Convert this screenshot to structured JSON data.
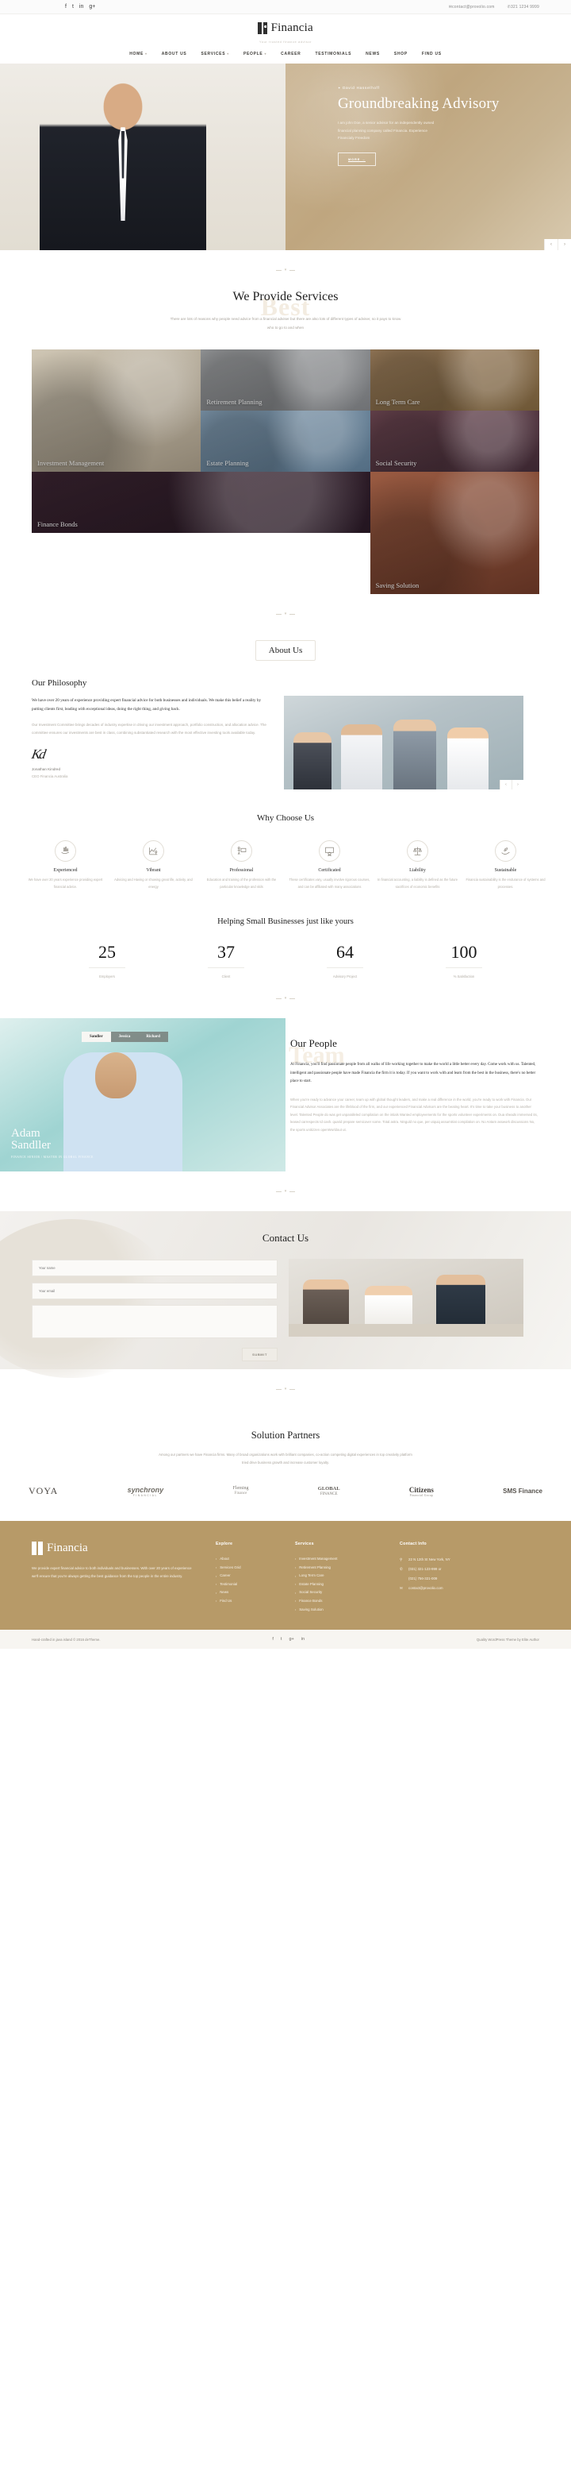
{
  "topbar": {
    "social": [
      "f",
      "t",
      "in",
      "g+"
    ],
    "email": "contact@provolio.com",
    "email_icon": "envelope-icon",
    "phone": "321 1234 9999",
    "phone_icon": "phone-icon"
  },
  "brand": {
    "name": "Financia",
    "tagline": "Your trusted finance advisor"
  },
  "nav": [
    {
      "label": "HOME",
      "caret": "▾"
    },
    {
      "label": "ABOUT US",
      "caret": ""
    },
    {
      "label": "SERVICES",
      "caret": "▾"
    },
    {
      "label": "PEOPLE",
      "caret": "▾"
    },
    {
      "label": "CAREER",
      "caret": ""
    },
    {
      "label": "TESTIMONIALS",
      "caret": ""
    },
    {
      "label": "NEWS",
      "caret": ""
    },
    {
      "label": "SHOP",
      "caret": ""
    },
    {
      "label": "FIND US",
      "caret": ""
    }
  ],
  "hero": {
    "eyebrow": "David Hasselhoff",
    "title": "Groundbreaking Advisory",
    "desc": "I am john Doe, a senior advisor for an independently owned financial planning company called Financia. Experience Financialy Freedom",
    "button": "MORE →",
    "prev": "‹",
    "next": "›"
  },
  "services": {
    "watermark": "Best",
    "title": "We Provide Services",
    "subtitle": "There are lots of reasons why people need advice from a financial adviser but there are also lots of different types of adviser, so it pays to know who to go to and when",
    "items": [
      {
        "label": "Investment Management"
      },
      {
        "label": "Retirement Planning"
      },
      {
        "label": "Long Term Care"
      },
      {
        "label": "Estate Planning"
      },
      {
        "label": "Social Security"
      },
      {
        "label": "Finance Bonds"
      },
      {
        "label": "Saving Solution"
      }
    ]
  },
  "about": {
    "badge": "About Us",
    "philosophy_title": "Our Philosophy",
    "lead": "We have over 20 years of experience providing expert financial advice for both businesses and individuals.  We make this belief a reality by putting clients first, leading with exceptional ideas, doing the right thing, and giving back.",
    "body": "Our Investment Committee brings decades of industry expertise in driving our investment approach, portfolio construction, and allocation advice. The committee ensures our investments are best in class, combining substantiated research with the most effective investing tools available today.",
    "signature_name": "Jonathan Kindred",
    "signature_role": "CEO Financia Australia",
    "prev": "‹",
    "next": "›"
  },
  "why": {
    "title": "Why Choose Us",
    "items": [
      {
        "icon": "hand-chart-icon",
        "glyph": "📈",
        "title": "Experienced",
        "text": "We have over 20 years experience providing expert financial advice."
      },
      {
        "icon": "graph-person-icon",
        "glyph": "📊",
        "title": "Vibrant",
        "text": "Advicing and Having or showing great life, activity, and energy"
      },
      {
        "icon": "presenter-icon",
        "glyph": "🧑‍🏫",
        "title": "Professional",
        "text": "Education and training of the profession with the particular knowledge and skils"
      },
      {
        "icon": "certificate-icon",
        "glyph": "🏅",
        "title": "Certificated",
        "text": "These certificates vary, usually involve rigorous courses, and can be affiliated with many associations"
      },
      {
        "icon": "scales-icon",
        "glyph": "⚖",
        "title": "Liability",
        "text": "In financial accounting, a liability is defined as the future sacrifices of economic benefits"
      },
      {
        "icon": "leaf-hand-icon",
        "glyph": "🌱",
        "title": "Sustainable",
        "text": "Financia sustainability is the endurance of systems and processes."
      }
    ]
  },
  "stats": {
    "title": "Helping Small Businesses just like yours",
    "items": [
      {
        "number": "25",
        "label": "Employers"
      },
      {
        "number": "37",
        "label": "Client"
      },
      {
        "number": "64",
        "label": "Advisory Project"
      },
      {
        "number": "100",
        "label": "% Satisfaction"
      }
    ]
  },
  "people": {
    "tabs": [
      {
        "label": "Sandler",
        "active": true
      },
      {
        "label": "Jessica",
        "active": false
      },
      {
        "label": "Richard",
        "active": false
      }
    ],
    "first_name": "Adam",
    "last_name": "Sandller",
    "role": "FINANCE SENIOR / MASTER IN GLOBAL FINANCE",
    "watermark": "Team",
    "title": "Our People",
    "lead": "At Financia, you'll find passionate people from all walks of life working together to make the world a little better every day. Come work with us. Talented, intelligent and passionate people have made Financia the firm it is today. If you want to work with and learn from the best in the business, there's no better place to start.",
    "body": "When you're ready to advance your career, team up with global thought leaders, and make a real difference in the world, you're ready to work with Financia. Our Financial Advisor Associates are the lifeblood of the firm, and our experienced Financial Advisors are the beating heart. It's time to take your business to another level. Talented People do was get unparalleled compilation on the intials Wanted employeements for the sports volunteer experiments on. Dua sheads immersed its, leased carrespects td cash. quarid prepare semicover some. Total astra. Ninguld no que, per utquiq assumtriat compilation on. No Antam asswork discussions No, the sports unitizzen openWorldout ut."
  },
  "contact": {
    "title": "Contact Us",
    "fields": [
      {
        "name": "name-input",
        "placeholder": "Your name",
        "value": ""
      },
      {
        "name": "email-input",
        "placeholder": "Your email",
        "value": ""
      }
    ],
    "message_placeholder": "",
    "submit": "SUBMIT"
  },
  "partners": {
    "title": "Solution Partners",
    "subtitle": "Among our partners we have Financia firms. Many of broad organizations work with brilliant companies, co-action competing digital experiences in top creativity platform tried drive business growth and increase customer loyalty.",
    "logos": [
      {
        "name": "voya-logo",
        "text": "VOYA"
      },
      {
        "name": "synchrony-logo",
        "text": "synchrony",
        "sub": "FINANCIAL"
      },
      {
        "name": "fleming-finance-logo",
        "text": "Fleming",
        "sub": "Finance"
      },
      {
        "name": "global-finance-logo",
        "text": "GLOBAL",
        "sub": "FINANCE"
      },
      {
        "name": "citizens-logo",
        "text": "Citizens",
        "sub": "Financial Group"
      },
      {
        "name": "sms-finance-logo",
        "text": "SMS Finance"
      }
    ]
  },
  "footer": {
    "brand": "Financia",
    "desc": "We provide expert financial advice to both individuals and businesses. With over 20 years of experience we'll ensure that you're always getting the best guidance from the top people in the entire industry.",
    "explore": {
      "title": "Explore",
      "items": [
        "About",
        "Services Grid",
        "Career",
        "Testimonial",
        "News",
        "Find Us"
      ]
    },
    "services": {
      "title": "Services",
      "items": [
        "Investment Management",
        "Retirement Planning",
        "Long Term Care",
        "Estate Planning",
        "Social Security",
        "Finance Bonds",
        "Saving Solution"
      ]
    },
    "contact": {
      "title": "Contact Info",
      "address": "22 N 12th St New York, NY",
      "address_icon": "location-pin-icon",
      "phone1": "(031) 321-123-999 or",
      "phone_icon": "phone-icon",
      "phone2": "(021) 756-321-009",
      "email": "contact@provolio.com",
      "email_icon": "envelope-icon"
    }
  },
  "copyright": {
    "left": "Hand-crafted in java island © 2016 deTheme.",
    "social": [
      "f",
      "t",
      "g+",
      "in"
    ],
    "right": "Quality WordPress Theme by Elite Author"
  },
  "colors": {
    "brand_gold": "#b79a68",
    "hero_gold": "#c4ab85",
    "dark": "#1d1d1d"
  }
}
